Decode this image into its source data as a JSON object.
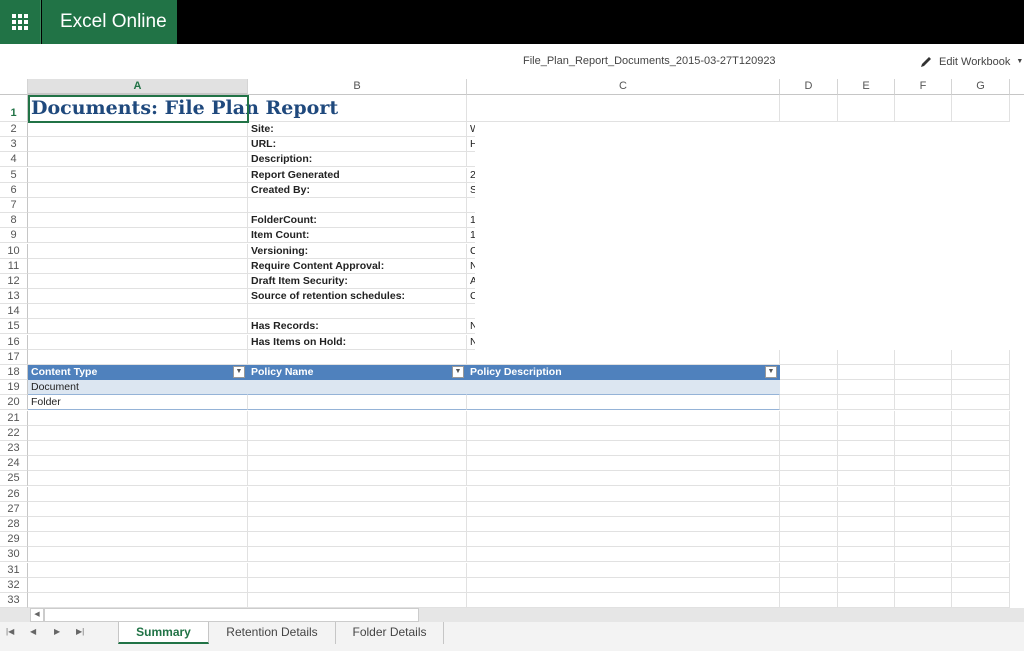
{
  "app": {
    "title": "Excel Online",
    "file_name": "File_Plan_Report_Documents_2015-03-27T120923",
    "edit_label": "Edit Workbook"
  },
  "columns": [
    "A",
    "B",
    "C",
    "D",
    "E",
    "F",
    "G"
  ],
  "title_cell": "Documents: File Plan Report",
  "rows": [
    {
      "n": "2",
      "b": "Site:",
      "c": "W"
    },
    {
      "n": "3",
      "b": "URL:",
      "c": "H"
    },
    {
      "n": "4",
      "b": "Description:",
      "c": ""
    },
    {
      "n": "5",
      "b": "Report Generated",
      "c": "2"
    },
    {
      "n": "6",
      "b": "Created By:",
      "c": "S"
    },
    {
      "n": "7",
      "b": "",
      "c": ""
    },
    {
      "n": "8",
      "b": "FolderCount:",
      "c": "1"
    },
    {
      "n": "9",
      "b": "Item Count:",
      "c": "1"
    },
    {
      "n": "10",
      "b": "Versioning:",
      "c": "C"
    },
    {
      "n": "11",
      "b": "Require Content Approval:",
      "c": "N"
    },
    {
      "n": "12",
      "b": "Draft Item Security:",
      "c": "A"
    },
    {
      "n": "13",
      "b": "Source of retention schedules:",
      "c": "C"
    },
    {
      "n": "14",
      "b": "",
      "c": ""
    },
    {
      "n": "15",
      "b": "Has Records:",
      "c": "N"
    },
    {
      "n": "16",
      "b": "Has Items on Hold:",
      "c": "N"
    },
    {
      "n": "17",
      "b": "",
      "c": ""
    }
  ],
  "table": {
    "headers": [
      "Content Type",
      "Policy Name",
      "Policy Description"
    ],
    "rows": [
      [
        "Document",
        "",
        ""
      ],
      [
        "Folder",
        "",
        ""
      ]
    ]
  },
  "empty_rows": [
    "21",
    "22",
    "23",
    "24",
    "25",
    "26",
    "27",
    "28",
    "29",
    "30",
    "31",
    "32",
    "33"
  ],
  "sheets": [
    {
      "label": "Summary",
      "active": true
    },
    {
      "label": "Retention Details"
    },
    {
      "label": "Folder Details"
    }
  ],
  "colors": {
    "brand": "#217346",
    "table_header": "#4f81bd",
    "table_band": "#dce6f1"
  }
}
